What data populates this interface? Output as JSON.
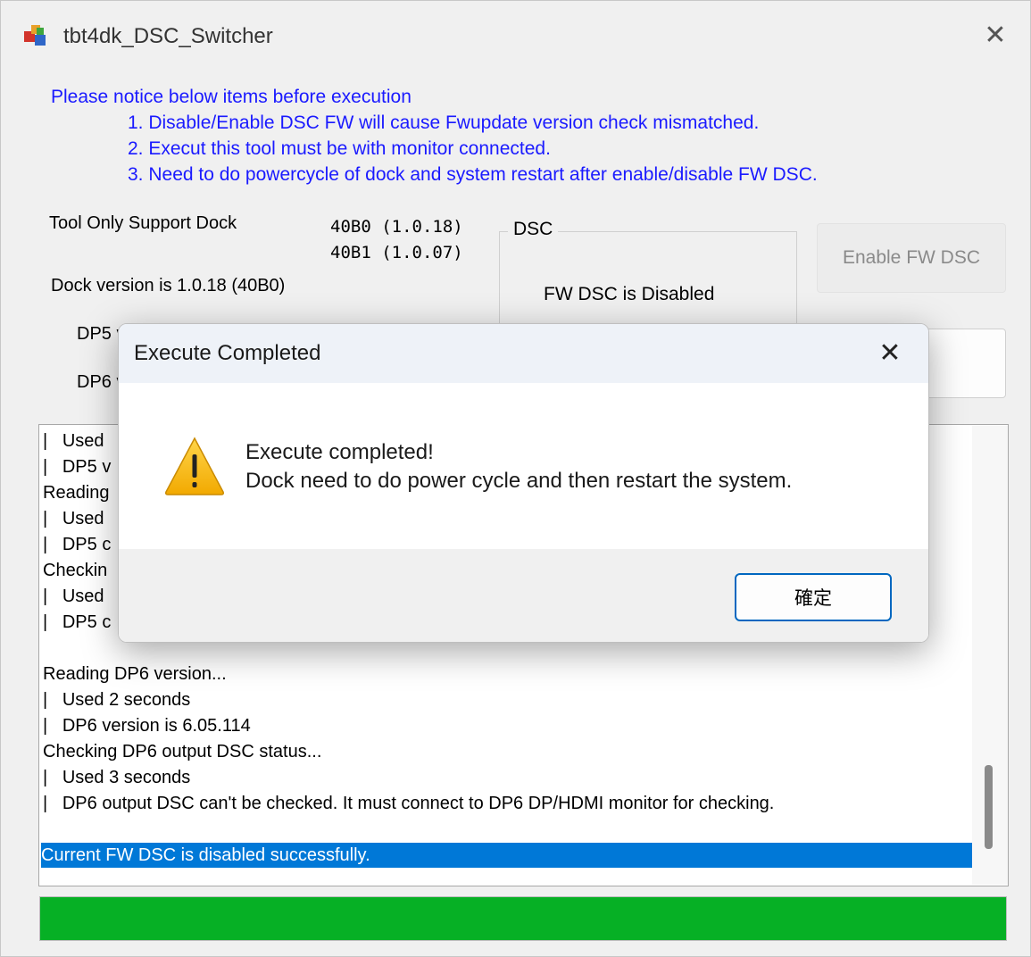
{
  "window": {
    "title": "tbt4dk_DSC_Switcher"
  },
  "notice": {
    "heading": "Please notice below items before execution",
    "items": [
      "1. Disable/Enable DSC FW will cause Fwupdate version check mismatched.",
      "2. Execut this tool must be with monitor connected.",
      "3. Need to do powercycle of dock and system restart after enable/disable FW DSC."
    ]
  },
  "info": {
    "support_label": "Tool Only Support Dock",
    "support_versions": [
      "40B0 (1.0.18)",
      "40B1 (1.0.07)"
    ],
    "dock_version": "Dock version is 1.0.18 (40B0)",
    "dp5_label_partial": "DP5 v",
    "dp6_label_partial": "DP6 v"
  },
  "dsc": {
    "legend": "DSC",
    "status": "FW DSC is Disabled"
  },
  "buttons": {
    "enable": "Enable FW DSC",
    "disable": ""
  },
  "log": {
    "lines": [
      "|   Used",
      "|   DP5 v",
      "Reading",
      "|   Used",
      "|   DP5 c",
      "Checkin",
      "|   Used",
      "|   DP5 c",
      "",
      "Reading DP6 version...",
      "|   Used 2 seconds",
      "|   DP6 version is 6.05.114",
      "Checking DP6 output DSC status...",
      "|   Used 3 seconds",
      "|   DP6 output DSC can't be checked. It must connect to DP6 DP/HDMI monitor for checking.",
      "",
      "Current FW DSC is disabled successfully."
    ],
    "selected_index": 16
  },
  "progress": {
    "fraction": 1.0,
    "color": "#06b025"
  },
  "dialog": {
    "title": "Execute Completed",
    "message_line1": "Execute completed!",
    "message_line2": "Dock need to do power cycle and then restart the system.",
    "ok_label": "確定",
    "icon": "warning-icon"
  }
}
